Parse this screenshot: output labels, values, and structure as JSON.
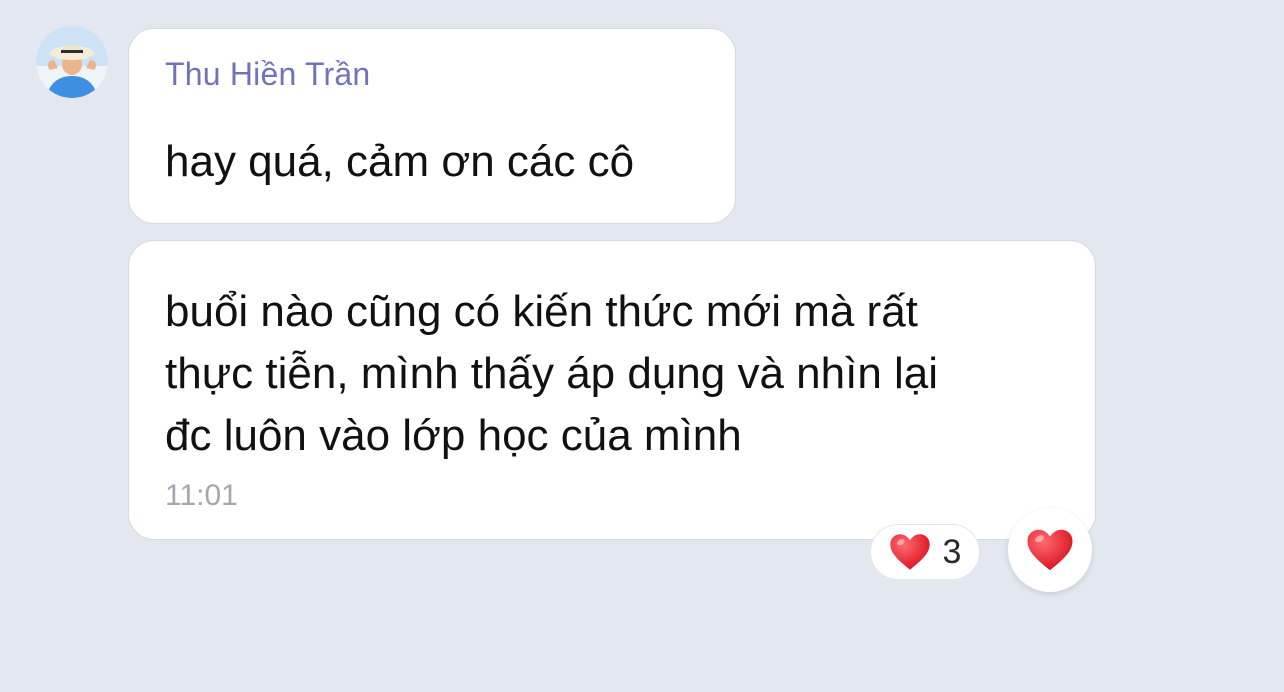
{
  "sender": {
    "name": "Thu Hiền Trần",
    "avatar_icon": "user-avatar-photo"
  },
  "messages": [
    {
      "text": "hay quá, cảm ơn các cô"
    },
    {
      "lines": [
        "buổi nào cũng có kiến thức mới mà rất",
        "thực tiễn, mình thấy áp dụng và nhìn lại",
        "đc luôn vào lớp học của mình"
      ],
      "time": "11:01",
      "reaction": {
        "icon": "heart-icon",
        "count": "3"
      }
    }
  ],
  "react_button": {
    "icon": "heart-icon"
  },
  "colors": {
    "background": "#e3e7f0",
    "bubble": "#ffffff",
    "sender_name": "#6f74b8",
    "time": "#a3a7ae",
    "heart": "#e8212f"
  }
}
